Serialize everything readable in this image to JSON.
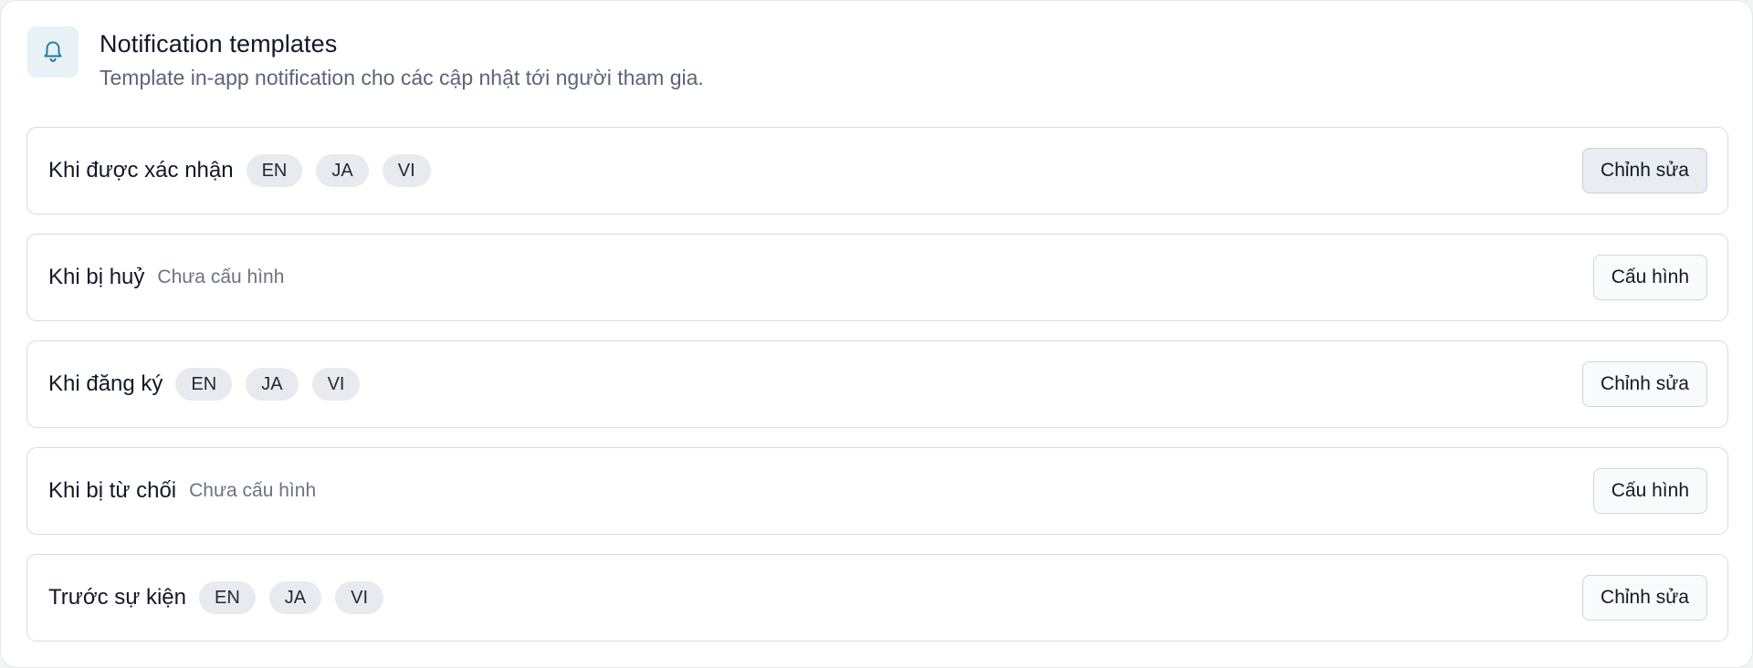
{
  "header": {
    "icon": "bell-icon",
    "title": "Notification templates",
    "subtitle": "Template in-app notification cho các cập nhật tới người tham gia."
  },
  "templates": [
    {
      "name": "Khi được xác nhận",
      "tags": [
        "EN",
        "JA",
        "VI"
      ],
      "status": "",
      "action": "Chỉnh sửa",
      "active": true
    },
    {
      "name": "Khi bị huỷ",
      "tags": [],
      "status": "Chưa cấu hình",
      "action": "Cấu hình",
      "active": false
    },
    {
      "name": "Khi đăng ký",
      "tags": [
        "EN",
        "JA",
        "VI"
      ],
      "status": "",
      "action": "Chỉnh sửa",
      "active": false
    },
    {
      "name": "Khi bị từ chối",
      "tags": [],
      "status": "Chưa cấu hình",
      "action": "Cấu hình",
      "active": false
    },
    {
      "name": "Trước sự kiện",
      "tags": [
        "EN",
        "JA",
        "VI"
      ],
      "status": "",
      "action": "Chỉnh sửa",
      "active": false
    }
  ],
  "colors": {
    "accent_icon": "#1e7aa8",
    "icon_background": "#e8f1f6",
    "tag_background": "#e8eaef",
    "border": "#d6dbe4"
  }
}
